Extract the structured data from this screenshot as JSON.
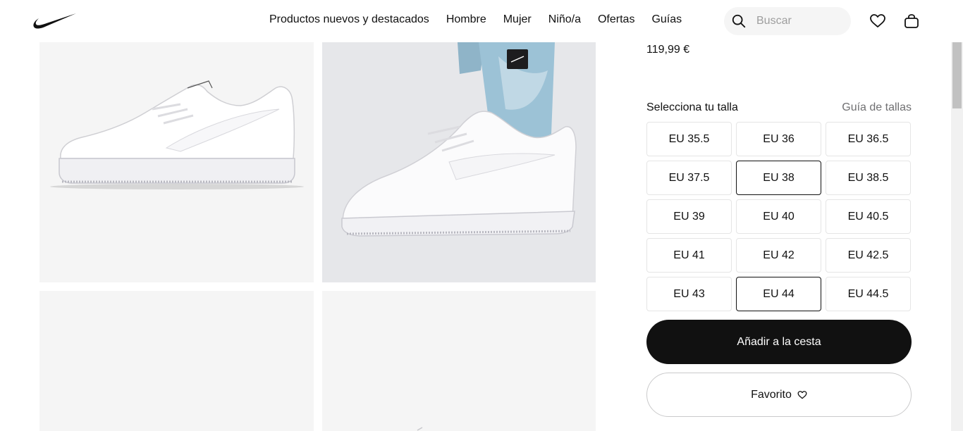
{
  "header": {
    "logo": "nike-swoosh-icon",
    "nav": [
      {
        "label": "Productos nuevos y destacados"
      },
      {
        "label": "Hombre"
      },
      {
        "label": "Mujer"
      },
      {
        "label": "Niño/a"
      },
      {
        "label": "Ofertas"
      },
      {
        "label": "Guías"
      }
    ],
    "search": {
      "placeholder": "Buscar",
      "icon": "search-icon"
    },
    "favorites_icon": "heart-icon",
    "bag_icon": "bag-icon"
  },
  "gallery": {
    "images": [
      {
        "icon": "sneaker-side-image"
      },
      {
        "icon": "sneaker-on-foot-image"
      },
      {
        "icon": "product-image-placeholder"
      },
      {
        "icon": "product-image-placeholder"
      }
    ]
  },
  "product": {
    "price": "119,99 €",
    "size_title": "Selecciona tu talla",
    "size_guide": "Guía de tallas",
    "sizes": [
      {
        "label": "EU 35.5",
        "selected": false
      },
      {
        "label": "EU 36",
        "selected": false
      },
      {
        "label": "EU 36.5",
        "selected": false
      },
      {
        "label": "EU 37.5",
        "selected": false
      },
      {
        "label": "EU 38",
        "selected": true
      },
      {
        "label": "EU 38.5",
        "selected": false
      },
      {
        "label": "EU 39",
        "selected": false
      },
      {
        "label": "EU 40",
        "selected": false
      },
      {
        "label": "EU 40.5",
        "selected": false
      },
      {
        "label": "EU 41",
        "selected": false
      },
      {
        "label": "EU 42",
        "selected": false
      },
      {
        "label": "EU 42.5",
        "selected": false
      },
      {
        "label": "EU 43",
        "selected": false
      },
      {
        "label": "EU 44",
        "selected": true
      },
      {
        "label": "EU 44.5",
        "selected": false
      }
    ],
    "add_to_bag": "Añadir a la cesta",
    "favorite": "Favorito",
    "favorite_icon": "heart-icon"
  },
  "colors": {
    "primary": "#111111",
    "tile_bg": "#f5f5f5",
    "secondary_text": "#707072"
  }
}
